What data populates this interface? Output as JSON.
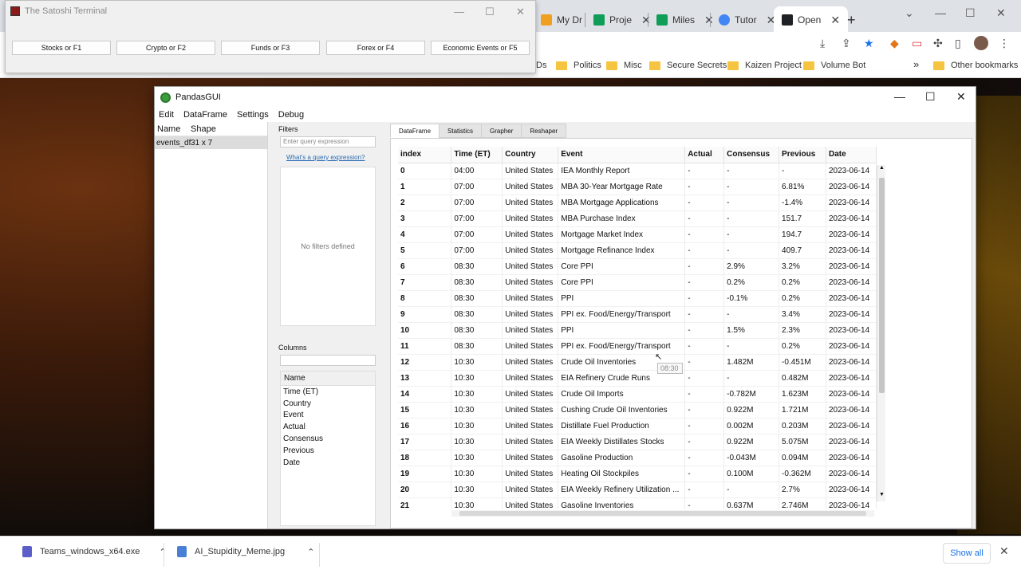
{
  "browser": {
    "tabs": [
      {
        "label": "My Dr",
        "color": "#f0a020"
      },
      {
        "label": "Proje",
        "color": "#0f9d58"
      },
      {
        "label": "Miles",
        "color": "#0f9d58"
      },
      {
        "label": "Tutor",
        "color": "#4285f4"
      },
      {
        "label": "Open",
        "color": "#202124"
      }
    ],
    "new_tab": "+",
    "bookmarks": [
      "Ds",
      "Politics",
      "Misc",
      "Secure Secrets",
      "Kaizen Project",
      "Volume Bot"
    ],
    "more_bookmarks": "»",
    "other_bookmarks": "Other bookmarks"
  },
  "satoshi": {
    "title": "The Satoshi Terminal",
    "buttons": [
      "Stocks or F1",
      "Crypto or F2",
      "Funds or F3",
      "Forex or F4",
      "Economic Events or F5"
    ]
  },
  "pandasgui": {
    "title": "PandasGUI",
    "menu": [
      "Edit",
      "DataFrame",
      "Settings",
      "Debug"
    ],
    "dflist": {
      "col_name": "Name",
      "col_shape": "Shape",
      "rows": [
        {
          "name": "events_df",
          "shape": "31 x 7"
        }
      ]
    },
    "filters": {
      "label": "Filters",
      "placeholder": "Enter query expression",
      "link": "What's a query expression?",
      "empty": "No filters defined"
    },
    "columns": {
      "label": "Columns",
      "header": "Name",
      "items": [
        "Time (ET)",
        "Country",
        "Event",
        "Actual",
        "Consensus",
        "Previous",
        "Date"
      ]
    },
    "tabs": [
      "DataFrame",
      "Statistics",
      "Grapher",
      "Reshaper"
    ],
    "active_tab": "DataFrame",
    "tooltip": "08:30",
    "table": {
      "headers": [
        "index",
        "Time (ET)",
        "Country",
        "Event",
        "Actual",
        "Consensus",
        "Previous",
        "Date"
      ],
      "rows": [
        [
          "0",
          "04:00",
          "United States",
          "IEA Monthly Report",
          "-",
          "-",
          "-",
          "2023-06-14"
        ],
        [
          "1",
          "07:00",
          "United States",
          "MBA 30-Year Mortgage Rate",
          "-",
          "-",
          "6.81%",
          "2023-06-14"
        ],
        [
          "2",
          "07:00",
          "United States",
          "MBA Mortgage Applications",
          "-",
          "-",
          "-1.4%",
          "2023-06-14"
        ],
        [
          "3",
          "07:00",
          "United States",
          "MBA Purchase Index",
          "-",
          "-",
          "151.7",
          "2023-06-14"
        ],
        [
          "4",
          "07:00",
          "United States",
          "Mortgage Market Index",
          "-",
          "-",
          "194.7",
          "2023-06-14"
        ],
        [
          "5",
          "07:00",
          "United States",
          "Mortgage Refinance Index",
          "-",
          "-",
          "409.7",
          "2023-06-14"
        ],
        [
          "6",
          "08:30",
          "United States",
          "Core PPI",
          "-",
          "2.9%",
          "3.2%",
          "2023-06-14"
        ],
        [
          "7",
          "08:30",
          "United States",
          "Core PPI",
          "-",
          "0.2%",
          "0.2%",
          "2023-06-14"
        ],
        [
          "8",
          "08:30",
          "United States",
          "PPI",
          "-",
          "-0.1%",
          "0.2%",
          "2023-06-14"
        ],
        [
          "9",
          "08:30",
          "United States",
          "PPI ex. Food/Energy/Transport",
          "-",
          "-",
          "3.4%",
          "2023-06-14"
        ],
        [
          "10",
          "08:30",
          "United States",
          "PPI",
          "-",
          "1.5%",
          "2.3%",
          "2023-06-14"
        ],
        [
          "11",
          "08:30",
          "United States",
          "PPI ex. Food/Energy/Transport",
          "-",
          "-",
          "0.2%",
          "2023-06-14"
        ],
        [
          "12",
          "10:30",
          "United States",
          "Crude Oil Inventories",
          "-",
          "1.482M",
          "-0.451M",
          "2023-06-14"
        ],
        [
          "13",
          "10:30",
          "United States",
          "EIA Refinery Crude Runs",
          "-",
          "-",
          "0.482M",
          "2023-06-14"
        ],
        [
          "14",
          "10:30",
          "United States",
          "Crude Oil Imports",
          "-",
          "-0.782M",
          "1.623M",
          "2023-06-14"
        ],
        [
          "15",
          "10:30",
          "United States",
          "Cushing Crude Oil Inventories",
          "-",
          "0.922M",
          "1.721M",
          "2023-06-14"
        ],
        [
          "16",
          "10:30",
          "United States",
          "Distillate Fuel Production",
          "-",
          "0.002M",
          "0.203M",
          "2023-06-14"
        ],
        [
          "17",
          "10:30",
          "United States",
          "EIA Weekly Distillates Stocks",
          "-",
          "0.922M",
          "5.075M",
          "2023-06-14"
        ],
        [
          "18",
          "10:30",
          "United States",
          "Gasoline Production",
          "-",
          "-0.043M",
          "0.094M",
          "2023-06-14"
        ],
        [
          "19",
          "10:30",
          "United States",
          "Heating Oil Stockpiles",
          "-",
          "0.100M",
          "-0.362M",
          "2023-06-14"
        ],
        [
          "20",
          "10:30",
          "United States",
          "EIA Weekly Refinery Utilization ...",
          "-",
          "-",
          "2.7%",
          "2023-06-14"
        ],
        [
          "21",
          "10:30",
          "United States",
          "Gasoline Inventories",
          "-",
          "0.637M",
          "2.746M",
          "2023-06-14"
        ]
      ]
    }
  },
  "downloads": {
    "items": [
      {
        "name": "Teams_windows_x64.exe",
        "color": "#5b5fc7"
      },
      {
        "name": "AI_Stupidity_Meme.jpg",
        "color": "#4a7fd6"
      }
    ],
    "show_all": "Show all"
  }
}
